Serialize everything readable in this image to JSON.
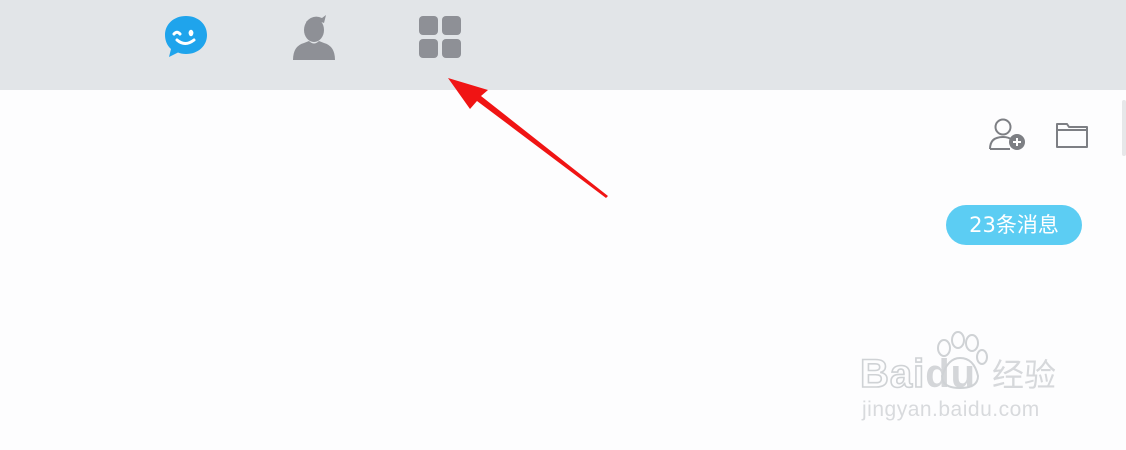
{
  "nav": {
    "tabs": [
      {
        "id": "chat",
        "icon": "chat-bubble-icon",
        "active": true,
        "color": "#1fa4ec"
      },
      {
        "id": "contacts",
        "icon": "contact-person-icon",
        "active": false,
        "color": "#8e9096"
      },
      {
        "id": "apps",
        "icon": "apps-grid-icon",
        "active": false,
        "color": "#8e9096"
      }
    ]
  },
  "toolbar": {
    "add_contact_icon": "add-contact-icon",
    "folder_icon": "folder-icon"
  },
  "messages": {
    "unread_badge": "23条消息",
    "badge_color": "#5ccdf3"
  },
  "annotation": {
    "arrow_color": "#f01414",
    "arrow_target": "apps-grid-icon"
  },
  "watermark": {
    "logo": "Baidu",
    "brand_cn": "经验",
    "url": "jingyan.baidu.com"
  }
}
